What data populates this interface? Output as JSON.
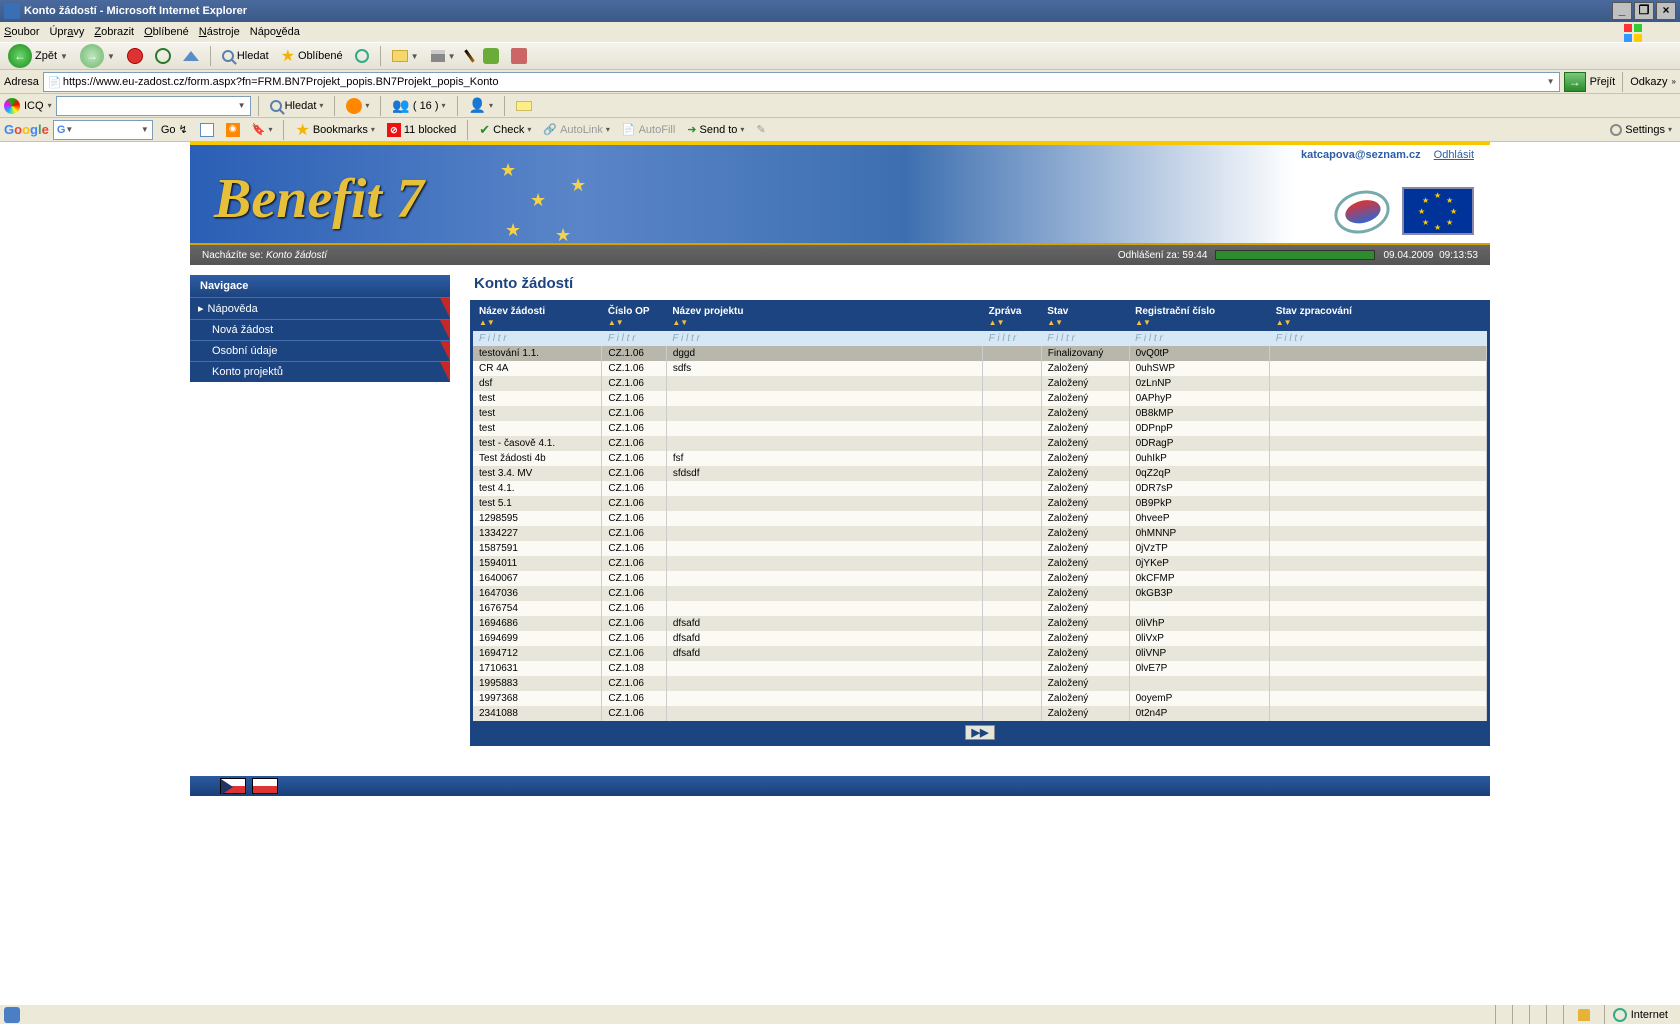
{
  "window": {
    "title": "Konto žádostí - Microsoft Internet Explorer"
  },
  "menubar": {
    "items": [
      "Soubor",
      "Úpravy",
      "Zobrazit",
      "Oblíbené",
      "Nástroje",
      "Nápověda"
    ]
  },
  "toolbar": {
    "back": "Zpět",
    "search": "Hledat",
    "favorites": "Oblíbené"
  },
  "addressbar": {
    "label": "Adresa",
    "url": "https://www.eu-zadost.cz/form.aspx?fn=FRM.BN7Projekt_popis.BN7Projekt_popis_Konto",
    "go": "Přejít",
    "links": "Odkazy"
  },
  "icqbar": {
    "label": "ICQ",
    "search": "Hledat",
    "count": "( 16 )"
  },
  "googlebar": {
    "go": "Go",
    "bookmarks": "Bookmarks",
    "blocked": "11 blocked",
    "check": "Check",
    "autolink": "AutoLink",
    "autofill": "AutoFill",
    "sendto": "Send to",
    "settings": "Settings"
  },
  "banner": {
    "email": "katcapova@seznam.cz",
    "logout": "Odhlásit"
  },
  "subbar": {
    "location_label": "Nacházíte se:",
    "location_value": "Konto žádostí",
    "logout_label": "Odhlášení za:",
    "logout_time": "59:44",
    "date": "09.04.2009",
    "time": "09:13:53"
  },
  "sidebar": {
    "title": "Navigace",
    "items": [
      {
        "label": "Nápověda",
        "icon": true
      },
      {
        "label": "Nová žádost"
      },
      {
        "label": "Osobní údaje"
      },
      {
        "label": "Konto projektů"
      }
    ]
  },
  "content": {
    "title": "Konto žádostí",
    "filter_label": "F i l t r",
    "columns": [
      "Název žádosti",
      "Číslo OP",
      "Název projektu",
      "Zpráva",
      "Stav",
      "Registrační číslo",
      "Stav zpracování"
    ],
    "rows": [
      {
        "c": [
          "testování 1.1.",
          "CZ.1.06",
          "dggd",
          "",
          "Finalizovaný",
          "0vQ0tP",
          ""
        ],
        "hl": true
      },
      {
        "c": [
          "CR 4A",
          "CZ.1.06",
          "sdfs",
          "",
          "Založený",
          "0uhSWP",
          ""
        ]
      },
      {
        "c": [
          "dsf",
          "CZ.1.06",
          "",
          "",
          "Založený",
          "0zLnNP",
          ""
        ]
      },
      {
        "c": [
          "test",
          "CZ.1.06",
          "",
          "",
          "Založený",
          "0APhyP",
          ""
        ]
      },
      {
        "c": [
          "test",
          "CZ.1.06",
          "",
          "",
          "Založený",
          "0B8kMP",
          ""
        ]
      },
      {
        "c": [
          "test",
          "CZ.1.06",
          "",
          "",
          "Založený",
          "0DPnpP",
          ""
        ]
      },
      {
        "c": [
          "test - časově 4.1.",
          "CZ.1.06",
          "",
          "",
          "Založený",
          "0DRagP",
          ""
        ]
      },
      {
        "c": [
          "Test žádosti 4b",
          "CZ.1.06",
          "fsf",
          "",
          "Založený",
          "0uhIkP",
          ""
        ]
      },
      {
        "c": [
          "test 3.4. MV",
          "CZ.1.06",
          "sfdsdf",
          "",
          "Založený",
          "0qZ2qP",
          ""
        ]
      },
      {
        "c": [
          "test 4.1.",
          "CZ.1.06",
          "",
          "",
          "Založený",
          "0DR7sP",
          ""
        ]
      },
      {
        "c": [
          "test 5.1",
          "CZ.1.06",
          "",
          "",
          "Založený",
          "0B9PkP",
          ""
        ]
      },
      {
        "c": [
          "1298595",
          "CZ.1.06",
          "",
          "",
          "Založený",
          "0hveeP",
          ""
        ]
      },
      {
        "c": [
          "1334227",
          "CZ.1.06",
          "",
          "",
          "Založený",
          "0hMNNP",
          ""
        ]
      },
      {
        "c": [
          "1587591",
          "CZ.1.06",
          "",
          "",
          "Založený",
          "0jVzTP",
          ""
        ]
      },
      {
        "c": [
          "1594011",
          "CZ.1.06",
          "",
          "",
          "Založený",
          "0jYKeP",
          ""
        ]
      },
      {
        "c": [
          "1640067",
          "CZ.1.06",
          "",
          "",
          "Založený",
          "0kCFMP",
          ""
        ]
      },
      {
        "c": [
          "1647036",
          "CZ.1.06",
          "",
          "",
          "Založený",
          "0kGB3P",
          ""
        ]
      },
      {
        "c": [
          "1676754",
          "CZ.1.06",
          "",
          "",
          "Založený",
          "",
          ""
        ]
      },
      {
        "c": [
          "1694686",
          "CZ.1.06",
          "dfsafd",
          "",
          "Založený",
          "0liVhP",
          ""
        ]
      },
      {
        "c": [
          "1694699",
          "CZ.1.06",
          "dfsafd",
          "",
          "Založený",
          "0liVxP",
          ""
        ]
      },
      {
        "c": [
          "1694712",
          "CZ.1.06",
          "dfsafd",
          "",
          "Založený",
          "0liVNP",
          ""
        ]
      },
      {
        "c": [
          "1710631",
          "CZ.1.08",
          "",
          "",
          "Založený",
          "0lvE7P",
          ""
        ]
      },
      {
        "c": [
          "1995883",
          "CZ.1.06",
          "",
          "",
          "Založený",
          "",
          ""
        ]
      },
      {
        "c": [
          "1997368",
          "CZ.1.06",
          "",
          "",
          "Založený",
          "0oyemP",
          ""
        ]
      },
      {
        "c": [
          "2341088",
          "CZ.1.06",
          "",
          "",
          "Založený",
          "0t2n4P",
          ""
        ]
      }
    ],
    "pager_next": "▶▶"
  },
  "statusbar": {
    "zone": "Internet"
  }
}
